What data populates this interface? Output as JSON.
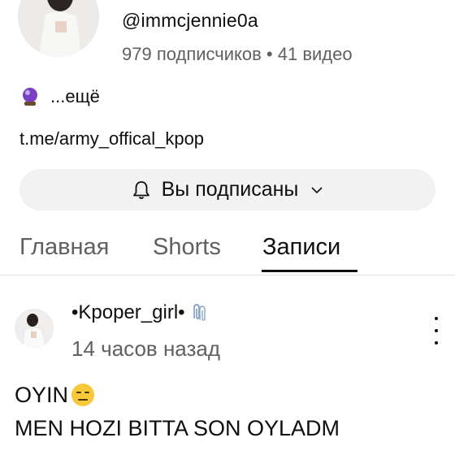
{
  "channel": {
    "handle": "@immcjennie0a",
    "stats": "979 подписчиков • 41 видео",
    "description_more": "...ещё",
    "link": "t.me/army_offical_kpop"
  },
  "subscribe": {
    "label": "Вы подписаны"
  },
  "tabs": [
    {
      "label": "Главная",
      "active": false
    },
    {
      "label": "Shorts",
      "active": false
    },
    {
      "label": "Записи",
      "active": true
    }
  ],
  "post": {
    "author": "•Kpoper_girl•",
    "time": "14 часов назад",
    "line1": "OYIN",
    "line2": "MEN HOZI BITTA SON OYLADM"
  },
  "colors": {
    "text_primary": "#0f0f0f",
    "text_secondary": "#606060",
    "button_bg": "#f2f2f2",
    "divider": "#e5e5e5"
  },
  "icons": [
    "crystal-ball-icon",
    "bell-icon",
    "chevron-down-icon",
    "paperclip-icon",
    "expressionless-face-icon",
    "more-vert-icon"
  ]
}
